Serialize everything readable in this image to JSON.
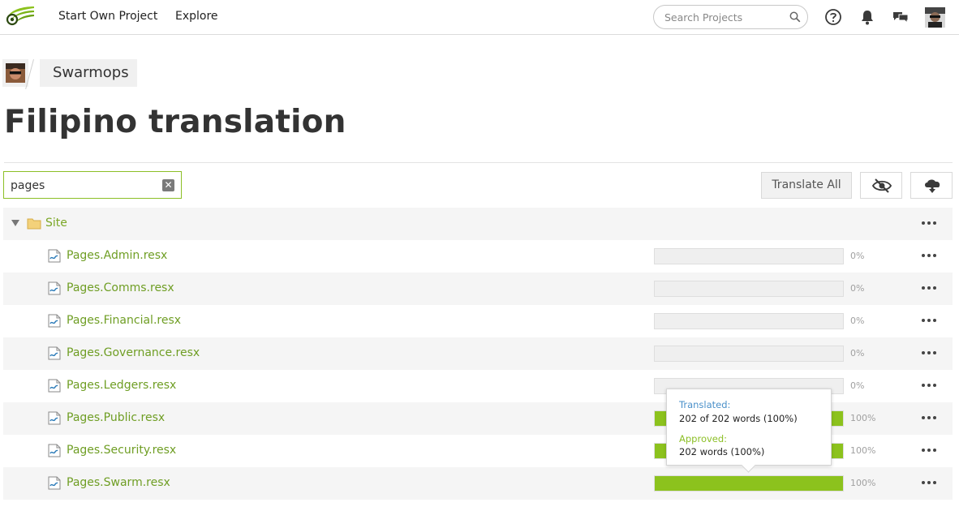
{
  "nav": {
    "start_project": "Start Own Project",
    "explore": "Explore",
    "search_placeholder": "Search Projects"
  },
  "breadcrumb": {
    "project": "Swarmops"
  },
  "page_title": "Filipino translation",
  "filter": {
    "value": "pages"
  },
  "toolbar": {
    "translate_all": "Translate All"
  },
  "folder": {
    "name": "Site"
  },
  "files": [
    {
      "name": "Pages.Admin.resx",
      "progress": 0,
      "percent": "0%"
    },
    {
      "name": "Pages.Comms.resx",
      "progress": 0,
      "percent": "0%"
    },
    {
      "name": "Pages.Financial.resx",
      "progress": 0,
      "percent": "0%"
    },
    {
      "name": "Pages.Governance.resx",
      "progress": 0,
      "percent": "0%"
    },
    {
      "name": "Pages.Ledgers.resx",
      "progress": 0,
      "percent": "0%"
    },
    {
      "name": "Pages.Public.resx",
      "progress": 100,
      "percent": "100%"
    },
    {
      "name": "Pages.Security.resx",
      "progress": 100,
      "percent": "100%"
    },
    {
      "name": "Pages.Swarm.resx",
      "progress": 100,
      "percent": "100%"
    }
  ],
  "tooltip": {
    "translated_label": "Translated:",
    "translated_value": "202 of 202 words (100%)",
    "approved_label": "Approved:",
    "approved_value": "202 words (100%)"
  },
  "colors": {
    "accent_green": "#8cc21d",
    "link_green": "#6f9e24",
    "translated_blue": "#4a90c9"
  }
}
